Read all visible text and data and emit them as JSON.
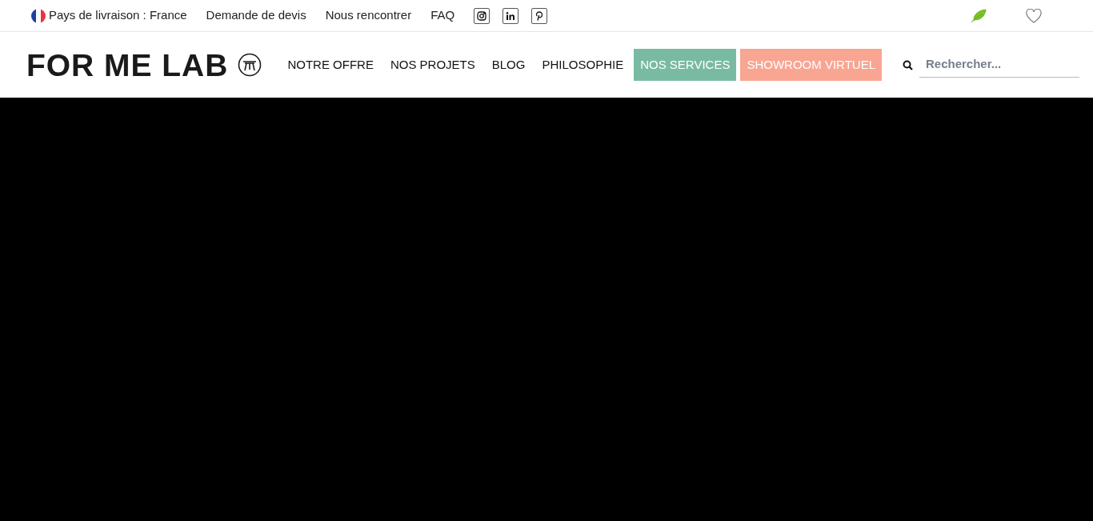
{
  "top_bar": {
    "delivery": "Pays de livraison : France",
    "links": [
      "Demande de devis",
      "Nous rencontrer",
      "FAQ"
    ],
    "socials": [
      {
        "kind": "instagram"
      },
      {
        "kind": "linkedin"
      },
      {
        "kind": "pinterest"
      }
    ]
  },
  "header": {
    "logo": "FOR ME LAB",
    "nav": [
      {
        "label": "NOTRE OFFRE",
        "kind": "plain"
      },
      {
        "label": "NOS PROJETS",
        "kind": "plain"
      },
      {
        "label": "BLOG",
        "kind": "plain"
      },
      {
        "label": "PHILOSOPHIE",
        "kind": "plain"
      },
      {
        "label": "NOS SERVICES",
        "kind": "filled",
        "color": "#79bba2"
      },
      {
        "label": "SHOWROOM VIRTUEL",
        "kind": "filled",
        "color": "#f8a592"
      }
    ],
    "search": {
      "placeholder": "Rechercher..."
    }
  }
}
